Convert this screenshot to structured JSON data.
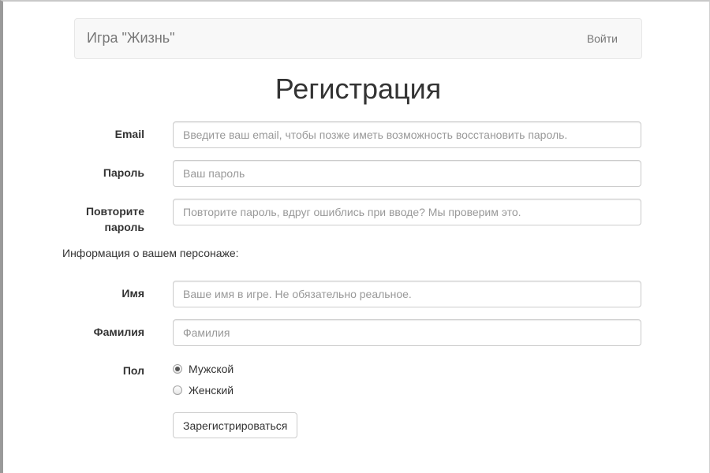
{
  "navbar": {
    "brand": "Игра \"Жизнь\"",
    "login": "Войти"
  },
  "title": "Регистрация",
  "form": {
    "email": {
      "label": "Email",
      "value": "",
      "placeholder": "Введите ваш email, чтобы позже иметь возможность восстановить пароль."
    },
    "password": {
      "label": "Пароль",
      "value": "",
      "placeholder": "Ваш пароль"
    },
    "password_repeat": {
      "label_line1": "Повторите",
      "label_line2": "пароль",
      "value": "",
      "placeholder": "Повторите пароль, вдруг ошиблись при вводе? Мы проверим это."
    },
    "character_info": "Информация о вашем персонаже:",
    "first_name": {
      "label": "Имя",
      "value": "",
      "placeholder": "Ваше имя в игре. Не обязательно реальное."
    },
    "last_name": {
      "label": "Фамилия",
      "value": "",
      "placeholder": "Фамилия"
    },
    "gender": {
      "label": "Пол",
      "options": [
        {
          "label": "Мужской",
          "selected": true
        },
        {
          "label": "Женский",
          "selected": false
        }
      ]
    },
    "submit": "Зарегистрироваться"
  }
}
